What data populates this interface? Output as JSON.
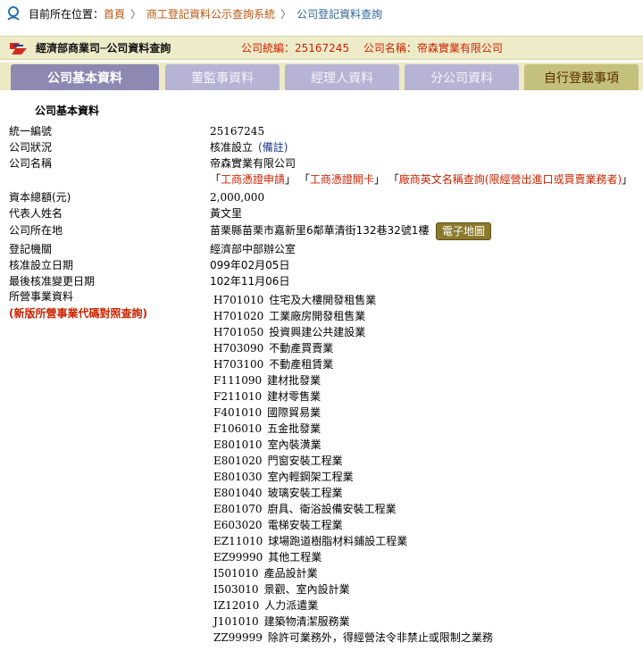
{
  "breadcrumb": {
    "prefix": "目前所在位置：",
    "home": "首頁",
    "system": "商工登記資料公示查詢系統",
    "current": "公司登記資料查詢"
  },
  "header": {
    "title": "經濟部商業司─公司資料查詢",
    "id_label": "公司統編：25167245",
    "name_label": "公司名稱：帝森實業有限公司"
  },
  "tabs": [
    {
      "label": "公司基本資料"
    },
    {
      "label": "董監事資料"
    },
    {
      "label": "經理人資料"
    },
    {
      "label": "分公司資料"
    },
    {
      "label": "自行登載事項"
    }
  ],
  "section_title": "公司基本資料",
  "fields": {
    "tax_id": {
      "label": "統一編號",
      "value": "25167245"
    },
    "status": {
      "label": "公司狀況",
      "value": "核准設立",
      "note": "(備註)"
    },
    "name": {
      "label": "公司名稱",
      "value": "帝森實業有限公司"
    },
    "links": {
      "l1": "工商憑證申請",
      "l2": "工商憑證開卡",
      "l3": "廠商英文名稱查詢(限經營出進口或買賣業務者)",
      "open": "「",
      "close": "」"
    },
    "capital": {
      "label": "資本總額(元)",
      "value": "2,000,000"
    },
    "rep": {
      "label": "代表人姓名",
      "value": "黃文里"
    },
    "address": {
      "label": "公司所在地",
      "value": "苗栗縣苗栗市嘉新里6鄰華清街132巷32號1樓",
      "map_button": "電子地圖"
    },
    "authority": {
      "label": "登記機關",
      "value": "經濟部中部辦公室"
    },
    "approve_date": {
      "label": "核准設立日期",
      "value": "099年02月05日"
    },
    "change_date": {
      "label": "最後核准變更日期",
      "value": "102年11月06日"
    },
    "business": {
      "label": "所營事業資料",
      "new_code_link": "(新版所營事業代碼對照查詢)"
    }
  },
  "business_items": [
    {
      "code": "H701010",
      "name": "住宅及大樓開發租售業"
    },
    {
      "code": "H701020",
      "name": "工業廠房開發租售業"
    },
    {
      "code": "H701050",
      "name": "投資興建公共建設業"
    },
    {
      "code": "H703090",
      "name": "不動產買賣業"
    },
    {
      "code": "H703100",
      "name": "不動產租賃業"
    },
    {
      "code": "F111090",
      "name": "建材批發業"
    },
    {
      "code": "F211010",
      "name": "建材零售業"
    },
    {
      "code": "F401010",
      "name": "國際貿易業"
    },
    {
      "code": "F106010",
      "name": "五金批發業"
    },
    {
      "code": "E801010",
      "name": "室內裝潢業"
    },
    {
      "code": "E801020",
      "name": "門窗安裝工程業"
    },
    {
      "code": "E801030",
      "name": "室內輕鋼架工程業"
    },
    {
      "code": "E801040",
      "name": "玻璃安裝工程業"
    },
    {
      "code": "E801070",
      "name": "廚具、衛浴設備安裝工程業"
    },
    {
      "code": "E603020",
      "name": "電梯安裝工程業"
    },
    {
      "code": "EZ11010",
      "name": "球場跑道樹脂材料鋪設工程業"
    },
    {
      "code": "EZ99990",
      "name": "其他工程業"
    },
    {
      "code": "I501010",
      "name": "產品設計業"
    },
    {
      "code": "I503010",
      "name": "景觀、室內設計業"
    },
    {
      "code": "IZ12010",
      "name": "人力派遣業"
    },
    {
      "code": "J101010",
      "name": "建築物清潔服務業"
    },
    {
      "code": "ZZ99999",
      "name": "除許可業務外，得經營法令非禁止或限制之業務"
    }
  ]
}
